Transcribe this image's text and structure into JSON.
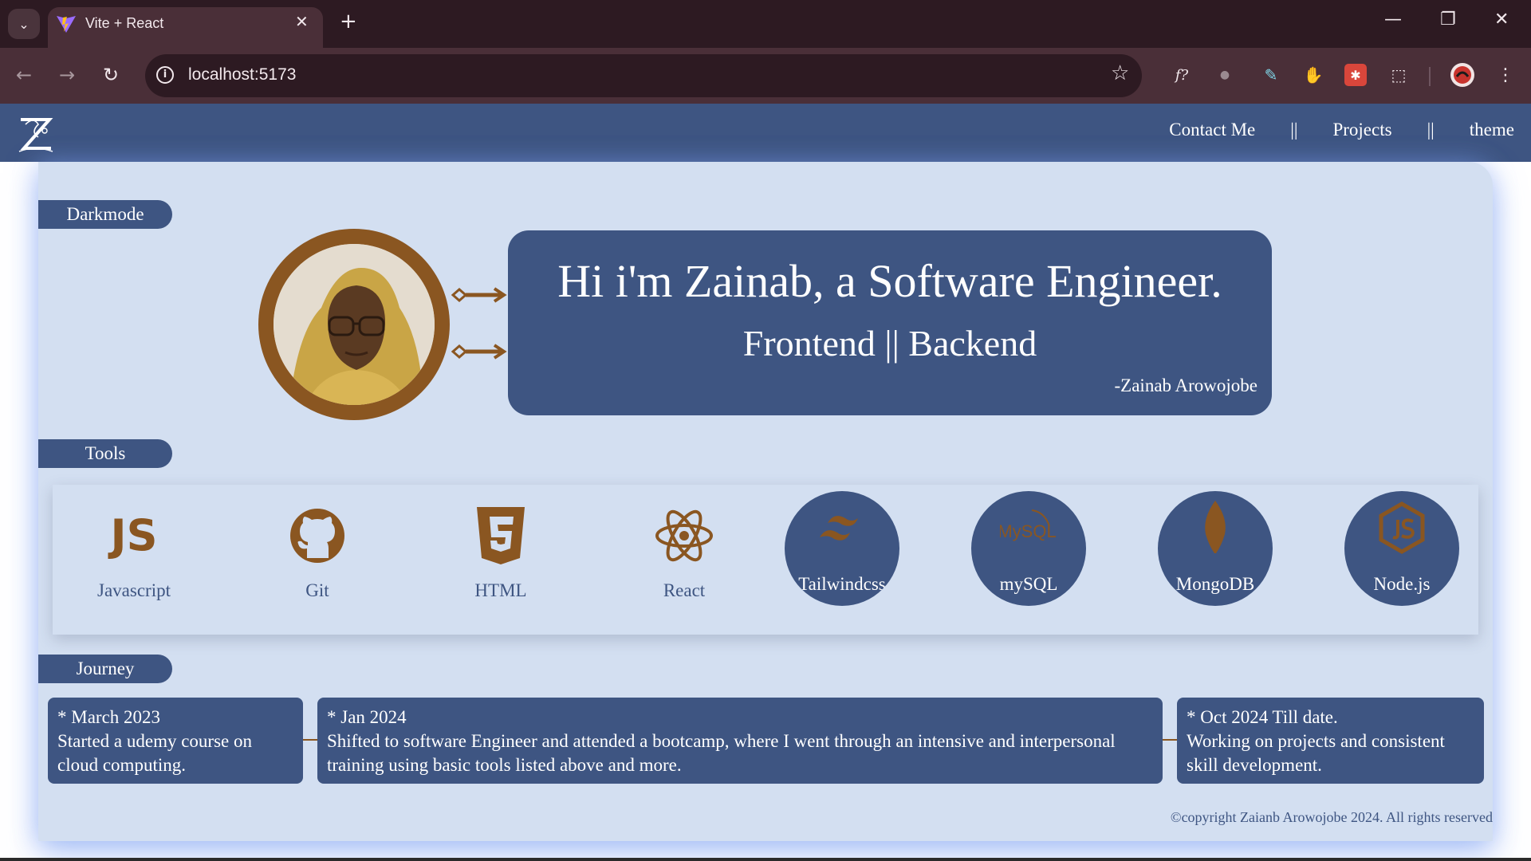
{
  "browser": {
    "tab_title": "Vite + React",
    "tab_close": "✕",
    "new_tab": "+",
    "url": "localhost:5173",
    "window_controls": {
      "minimize": "—",
      "restore": "❐",
      "close": "✕"
    },
    "nav": {
      "back": "←",
      "forward": "→",
      "reload": "↻"
    },
    "extensions": [
      "font-inspector-icon",
      "ghost-icon",
      "eyedropper-icon",
      "hand-icon",
      "puzzle-red-icon",
      "extensions-icon"
    ],
    "ext_glyphs": {
      "font": "f?",
      "ghost": "●",
      "eyedropper": "✎",
      "hand": "✋",
      "red": "✱",
      "puzzle": "⬚",
      "menu": "⋮",
      "tab_menu": "⌄",
      "star": "☆",
      "info": "i"
    }
  },
  "site": {
    "nav_links": [
      "Contact Me",
      "Projects",
      "theme"
    ],
    "nav_separator": "||",
    "darkmode_label": "Darkmode",
    "hero": {
      "title": "Hi i'm Zainab, a Software Engineer.",
      "subtitle": "Frontend || Backend",
      "signature": "-Zainab Arowojobe"
    },
    "tools_label": "Tools",
    "tools": [
      {
        "name": "Javascript",
        "icon": "js-icon"
      },
      {
        "name": "Git",
        "icon": "github-icon"
      },
      {
        "name": "HTML",
        "icon": "html5-icon"
      },
      {
        "name": "React",
        "icon": "react-icon"
      },
      {
        "name": "Tailwindcss",
        "icon": "tailwind-icon"
      },
      {
        "name": "mySQL",
        "icon": "mysql-icon"
      },
      {
        "name": "MongoDB",
        "icon": "mongodb-icon"
      },
      {
        "name": "Node.js",
        "icon": "nodejs-icon"
      }
    ],
    "icon_text": {
      "js": "JS",
      "mysql": "MySQL"
    },
    "journey_label": "Journey",
    "journey": [
      {
        "date": "* March 2023",
        "text": "Started a udemy course on cloud computing."
      },
      {
        "date": "* Jan 2024",
        "text": "Shifted to software Engineer and attended a bootcamp, where I went through an intensive and interpersonal training using basic tools listed above and more."
      },
      {
        "date": "* Oct 2024 Till date.",
        "text": "Working on projects and consistent skill development."
      }
    ],
    "copyright": "©copyright Zaianb Arowojobe 2024. All rights reserved"
  },
  "colors": {
    "chrome_dark": "#2d1a22",
    "chrome_toolbar": "#4a2f38",
    "brand_navy": "#3e5582",
    "card_bg": "#d3dff1",
    "accent_brown": "#8a5621"
  }
}
